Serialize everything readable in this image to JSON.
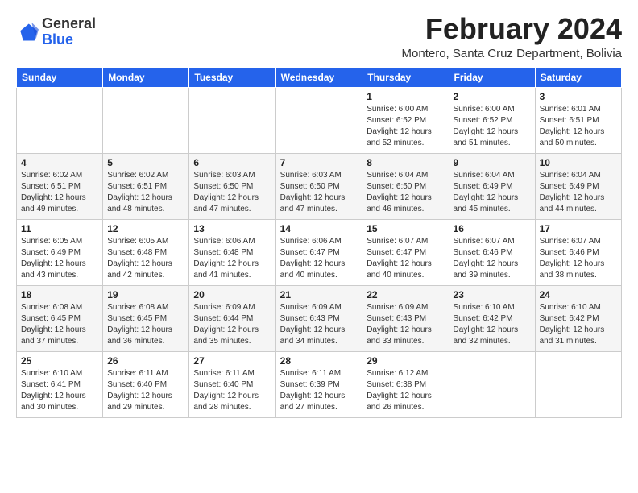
{
  "logo": {
    "line1": "General",
    "line2": "Blue"
  },
  "title": "February 2024",
  "subtitle": "Montero, Santa Cruz Department, Bolivia",
  "weekdays": [
    "Sunday",
    "Monday",
    "Tuesday",
    "Wednesday",
    "Thursday",
    "Friday",
    "Saturday"
  ],
  "weeks": [
    [
      {
        "day": "",
        "info": ""
      },
      {
        "day": "",
        "info": ""
      },
      {
        "day": "",
        "info": ""
      },
      {
        "day": "",
        "info": ""
      },
      {
        "day": "1",
        "info": "Sunrise: 6:00 AM\nSunset: 6:52 PM\nDaylight: 12 hours\nand 52 minutes."
      },
      {
        "day": "2",
        "info": "Sunrise: 6:00 AM\nSunset: 6:52 PM\nDaylight: 12 hours\nand 51 minutes."
      },
      {
        "day": "3",
        "info": "Sunrise: 6:01 AM\nSunset: 6:51 PM\nDaylight: 12 hours\nand 50 minutes."
      }
    ],
    [
      {
        "day": "4",
        "info": "Sunrise: 6:02 AM\nSunset: 6:51 PM\nDaylight: 12 hours\nand 49 minutes."
      },
      {
        "day": "5",
        "info": "Sunrise: 6:02 AM\nSunset: 6:51 PM\nDaylight: 12 hours\nand 48 minutes."
      },
      {
        "day": "6",
        "info": "Sunrise: 6:03 AM\nSunset: 6:50 PM\nDaylight: 12 hours\nand 47 minutes."
      },
      {
        "day": "7",
        "info": "Sunrise: 6:03 AM\nSunset: 6:50 PM\nDaylight: 12 hours\nand 47 minutes."
      },
      {
        "day": "8",
        "info": "Sunrise: 6:04 AM\nSunset: 6:50 PM\nDaylight: 12 hours\nand 46 minutes."
      },
      {
        "day": "9",
        "info": "Sunrise: 6:04 AM\nSunset: 6:49 PM\nDaylight: 12 hours\nand 45 minutes."
      },
      {
        "day": "10",
        "info": "Sunrise: 6:04 AM\nSunset: 6:49 PM\nDaylight: 12 hours\nand 44 minutes."
      }
    ],
    [
      {
        "day": "11",
        "info": "Sunrise: 6:05 AM\nSunset: 6:49 PM\nDaylight: 12 hours\nand 43 minutes."
      },
      {
        "day": "12",
        "info": "Sunrise: 6:05 AM\nSunset: 6:48 PM\nDaylight: 12 hours\nand 42 minutes."
      },
      {
        "day": "13",
        "info": "Sunrise: 6:06 AM\nSunset: 6:48 PM\nDaylight: 12 hours\nand 41 minutes."
      },
      {
        "day": "14",
        "info": "Sunrise: 6:06 AM\nSunset: 6:47 PM\nDaylight: 12 hours\nand 40 minutes."
      },
      {
        "day": "15",
        "info": "Sunrise: 6:07 AM\nSunset: 6:47 PM\nDaylight: 12 hours\nand 40 minutes."
      },
      {
        "day": "16",
        "info": "Sunrise: 6:07 AM\nSunset: 6:46 PM\nDaylight: 12 hours\nand 39 minutes."
      },
      {
        "day": "17",
        "info": "Sunrise: 6:07 AM\nSunset: 6:46 PM\nDaylight: 12 hours\nand 38 minutes."
      }
    ],
    [
      {
        "day": "18",
        "info": "Sunrise: 6:08 AM\nSunset: 6:45 PM\nDaylight: 12 hours\nand 37 minutes."
      },
      {
        "day": "19",
        "info": "Sunrise: 6:08 AM\nSunset: 6:45 PM\nDaylight: 12 hours\nand 36 minutes."
      },
      {
        "day": "20",
        "info": "Sunrise: 6:09 AM\nSunset: 6:44 PM\nDaylight: 12 hours\nand 35 minutes."
      },
      {
        "day": "21",
        "info": "Sunrise: 6:09 AM\nSunset: 6:43 PM\nDaylight: 12 hours\nand 34 minutes."
      },
      {
        "day": "22",
        "info": "Sunrise: 6:09 AM\nSunset: 6:43 PM\nDaylight: 12 hours\nand 33 minutes."
      },
      {
        "day": "23",
        "info": "Sunrise: 6:10 AM\nSunset: 6:42 PM\nDaylight: 12 hours\nand 32 minutes."
      },
      {
        "day": "24",
        "info": "Sunrise: 6:10 AM\nSunset: 6:42 PM\nDaylight: 12 hours\nand 31 minutes."
      }
    ],
    [
      {
        "day": "25",
        "info": "Sunrise: 6:10 AM\nSunset: 6:41 PM\nDaylight: 12 hours\nand 30 minutes."
      },
      {
        "day": "26",
        "info": "Sunrise: 6:11 AM\nSunset: 6:40 PM\nDaylight: 12 hours\nand 29 minutes."
      },
      {
        "day": "27",
        "info": "Sunrise: 6:11 AM\nSunset: 6:40 PM\nDaylight: 12 hours\nand 28 minutes."
      },
      {
        "day": "28",
        "info": "Sunrise: 6:11 AM\nSunset: 6:39 PM\nDaylight: 12 hours\nand 27 minutes."
      },
      {
        "day": "29",
        "info": "Sunrise: 6:12 AM\nSunset: 6:38 PM\nDaylight: 12 hours\nand 26 minutes."
      },
      {
        "day": "",
        "info": ""
      },
      {
        "day": "",
        "info": ""
      }
    ]
  ]
}
